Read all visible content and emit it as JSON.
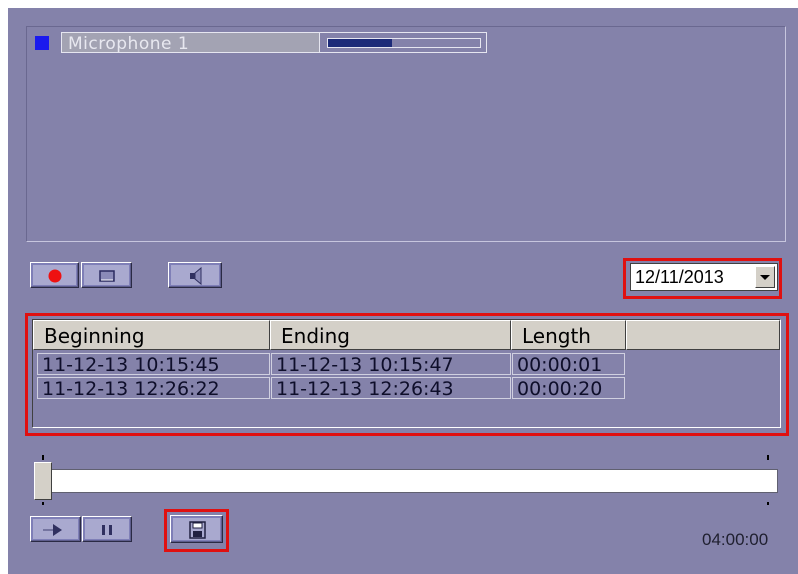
{
  "channel": {
    "name": "Microphone 1",
    "level_fraction": 0.42,
    "indicator_color": "#1a1aee"
  },
  "controls": {
    "record_icon": "record-icon",
    "stop_icon": "stop-icon",
    "mute_icon": "speaker-icon"
  },
  "date_picker": {
    "value": "12/11/2013"
  },
  "recordings": {
    "columns": [
      "Beginning",
      "Ending",
      "Length"
    ],
    "rows": [
      [
        "11-12-13 10:15:45",
        "11-12-13 10:15:47",
        "00:00:01"
      ],
      [
        "11-12-13 12:26:22",
        "11-12-13 12:26:43",
        "00:00:20"
      ]
    ]
  },
  "timeline": {
    "position_fraction": 0.0,
    "duration": "04:00:00"
  },
  "playback": {
    "play_icon": "play-icon",
    "pause_icon": "pause-icon",
    "save_icon": "save-icon"
  },
  "colors": {
    "background": "#8482aa",
    "highlight": "#e01010",
    "level": "#1c2a78"
  }
}
